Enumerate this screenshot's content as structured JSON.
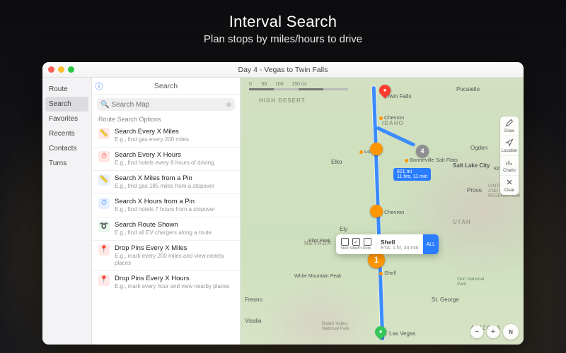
{
  "hero": {
    "title": "Interval Search",
    "subtitle": "Plan stops by miles/hours to drive"
  },
  "window": {
    "title": "Day 4 - Vegas to Twin Falls"
  },
  "sidebar": {
    "items": [
      {
        "label": "Route"
      },
      {
        "label": "Search"
      },
      {
        "label": "Favorites"
      },
      {
        "label": "Recents"
      },
      {
        "label": "Contacts"
      },
      {
        "label": "Turns"
      }
    ],
    "selected": 1
  },
  "panel": {
    "title": "Search",
    "search_placeholder": "Search Map",
    "group_label": "Route Search Options",
    "options": [
      {
        "icon": "ruler-red",
        "title": "Search Every X Miles",
        "sub": "E.g., find gas every 200 miles"
      },
      {
        "icon": "clock-red",
        "title": "Search Every X Hours",
        "sub": "E.g., find hotels every 8 hours of driving."
      },
      {
        "icon": "ruler-blue",
        "title": "Search X Miles from a Pin",
        "sub": "E.g., find gas 185 miles from a stopover"
      },
      {
        "icon": "clock-blue",
        "title": "Search X Hours from a Pin",
        "sub": "E.g., find hotels 7 hours from a stopover"
      },
      {
        "icon": "route-green",
        "title": "Search Route Shown",
        "sub": "E.g., find all EV chargers along a route"
      },
      {
        "icon": "drop-red",
        "title": "Drop Pins Every X Miles",
        "sub": "E.g., mark every 200 miles and view nearby places"
      },
      {
        "icon": "drop-red",
        "title": "Drop Pins Every X Hours",
        "sub": "E.g., mark every hour and view nearby places"
      }
    ]
  },
  "map": {
    "scale_labels": [
      "0",
      "50",
      "100",
      "150 mi"
    ],
    "states": {
      "idaho": "IDAHO",
      "nevada": "NEVADA",
      "utah": "UTAH",
      "arizona": "ARIZONA",
      "highdesert": "HIGH DESERT"
    },
    "cities": {
      "twinfalls": "Twin Falls",
      "pocatello": "Pocatello",
      "elko": "Elko",
      "ogden": "Ogden",
      "slc": "Salt Lake City",
      "kingspeak": "Kings Peak",
      "provo": "Provo",
      "pilotpeak": "Pilot Peak",
      "ely": "Ely",
      "whitemtn": "White Mountain Peak",
      "stgeorge": "St. George",
      "fresno": "Fresno",
      "visalia": "Visalia",
      "lasvegas": "Las Vegas",
      "uintah": "UINTAH\nAND OURAY\nRESERVATION",
      "zion": "Zion National\nPark",
      "deathvalley": "Death Valley\nNational Park"
    },
    "pois": {
      "chevron_n": "Chevron",
      "loves": "Love's",
      "bonneville": "Bonneville Salt Flats",
      "chevron_m": "Chevron",
      "shell_s": "Shell"
    },
    "route_bubble": {
      "dist": "821 mi",
      "time": "11 hrs, 11 min"
    },
    "callout": {
      "b1": "Start",
      "b2": "WayPt",
      "b3": "Dest.",
      "name": "Shell",
      "eta": "ETA: 1 hr, 34 min",
      "tail": "ALL"
    },
    "waypoints": {
      "wp1": "1",
      "wp4": "4"
    },
    "tools": [
      {
        "icon": "pencil",
        "label": "Draw"
      },
      {
        "icon": "target",
        "label": "Location"
      },
      {
        "icon": "barchart",
        "label": "Charts"
      },
      {
        "icon": "x",
        "label": "Clear"
      }
    ],
    "compass": "N"
  }
}
